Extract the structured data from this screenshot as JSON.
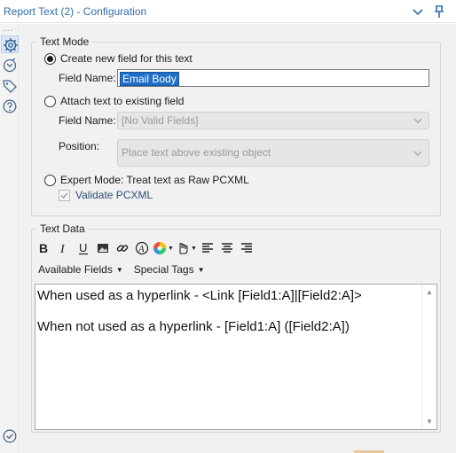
{
  "title_bar": {
    "title": "Report Text (2) - Configuration",
    "icons": [
      "chevron-down-icon",
      "pin-icon"
    ]
  },
  "sidebar": {
    "dots": "...",
    "icons": [
      "gear-icon",
      "connections-icon",
      "tag-icon",
      "help-icon",
      "check-circle-icon"
    ]
  },
  "text_mode": {
    "legend": "Text Mode",
    "create_new": {
      "label": "Create new field for this text",
      "checked": true
    },
    "field_name_label_1": "Field Name:",
    "field_name_value": "Email Body",
    "attach_existing": {
      "label": "Attach text to existing field",
      "checked": false
    },
    "field_name_label_2": "Field Name:",
    "field_name_select": "[No Valid Fields]",
    "position_label": "Position:",
    "position_select": "Place text above existing object",
    "expert_mode": {
      "label": "Expert Mode: Treat text as Raw PCXML",
      "checked": false
    },
    "validate_pcxml": {
      "label": "Validate PCXML",
      "checked": true
    }
  },
  "text_data": {
    "legend": "Text Data",
    "toolbar_icons": [
      "bold-icon",
      "italic-icon",
      "underline-icon",
      "image-icon",
      "link-icon",
      "font-icon",
      "color-wheel-icon",
      "hand-dropdown-icon",
      "align-left-icon",
      "align-center-icon",
      "align-right-icon"
    ],
    "available_fields": "Available Fields",
    "special_tags": "Special Tags",
    "line1": "When used as a hyperlink - <Link [Field1:A]|[Field2:A]>",
    "line2": "When not used as a hyperlink - [Field1:A] ([Field2:A])"
  },
  "colors": {
    "title_text": "#2f6ea8",
    "selection": "#1e6ec8",
    "panel_bg": "#f1f1f1"
  }
}
